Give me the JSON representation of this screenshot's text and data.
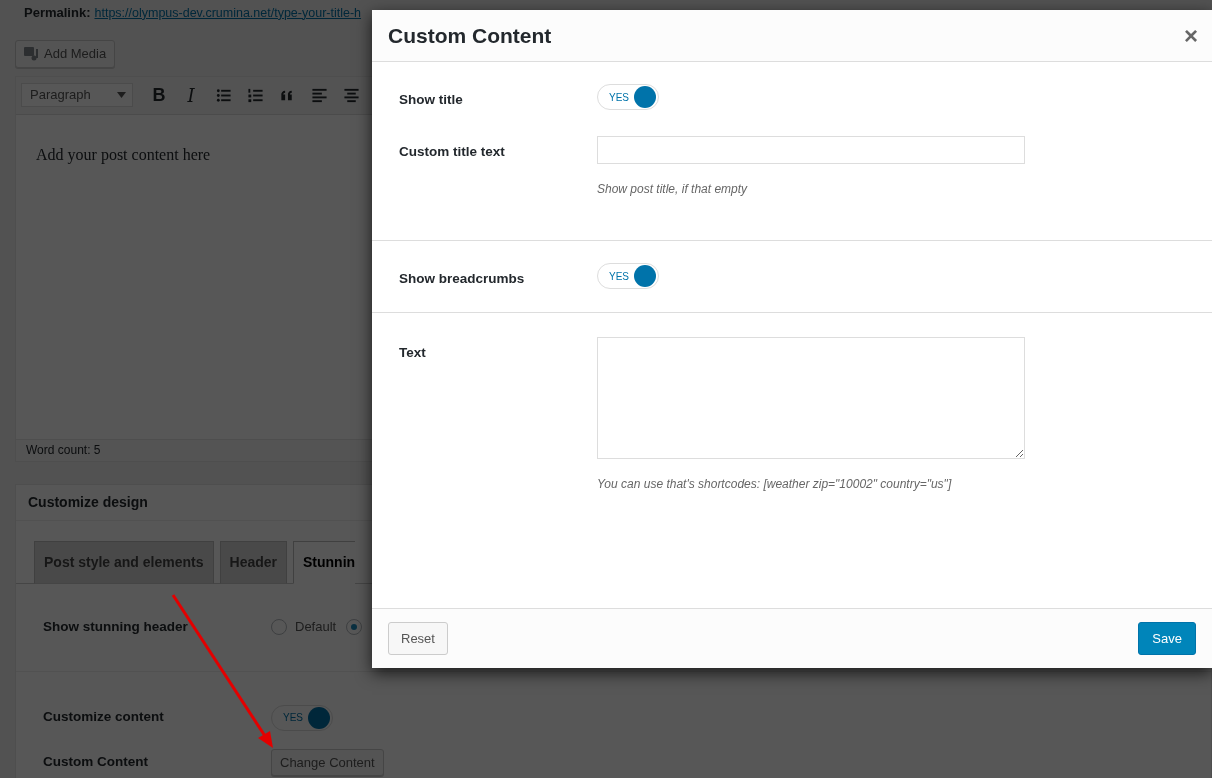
{
  "permalink": {
    "label": "Permalink:",
    "url": "https://olympus-dev.crumina.net/type-your-title-h"
  },
  "add_media_button": "Add Media",
  "editor": {
    "format_select": "Paragraph",
    "toolbar": [
      {
        "kind": "bold",
        "glyph": "B"
      },
      {
        "kind": "italic",
        "glyph": "I"
      },
      {
        "kind": "bullets"
      },
      {
        "kind": "numbers"
      },
      {
        "kind": "quote"
      },
      {
        "kind": "align-left"
      },
      {
        "kind": "align-center"
      }
    ],
    "content": "Add your post content here",
    "word_count": "Word count: 5"
  },
  "customize_design": {
    "title": "Customize design",
    "tabs": [
      {
        "label": "Post style and elements",
        "selected": false
      },
      {
        "label": "Header",
        "selected": false
      },
      {
        "label": "Stunnin",
        "selected": true
      }
    ],
    "rows": [
      {
        "kind": "radio",
        "label": "Show stunning header",
        "options": [
          {
            "label": "Default",
            "selected": false
          },
          {
            "selected": true
          }
        ]
      },
      {
        "kind": "toggle",
        "label": "Customize content",
        "on": true,
        "toggle_text": "YES"
      },
      {
        "kind": "button",
        "label": "Custom Content",
        "button": "Change Content"
      }
    ]
  },
  "modal": {
    "title": "Custom Content",
    "close": "×",
    "sections": [
      {
        "fields": [
          {
            "kind": "toggle",
            "label": "Show title",
            "on": true,
            "toggle_text": "YES"
          },
          {
            "kind": "text",
            "label": "Custom title text",
            "hint": "Show post title, if that empty"
          }
        ]
      },
      {
        "fields": [
          {
            "kind": "toggle",
            "label": "Show breadcrumbs",
            "on": true,
            "toggle_text": "YES"
          }
        ]
      },
      {
        "fields": [
          {
            "kind": "textarea",
            "label": "Text",
            "hint": "You can use that's shortcodes: [weather zip=\"10002\" country=\"us\"]"
          }
        ]
      }
    ],
    "buttons": [
      {
        "label": "Reset",
        "kind": "secondary"
      },
      {
        "label": "Save",
        "kind": "primary"
      }
    ]
  }
}
